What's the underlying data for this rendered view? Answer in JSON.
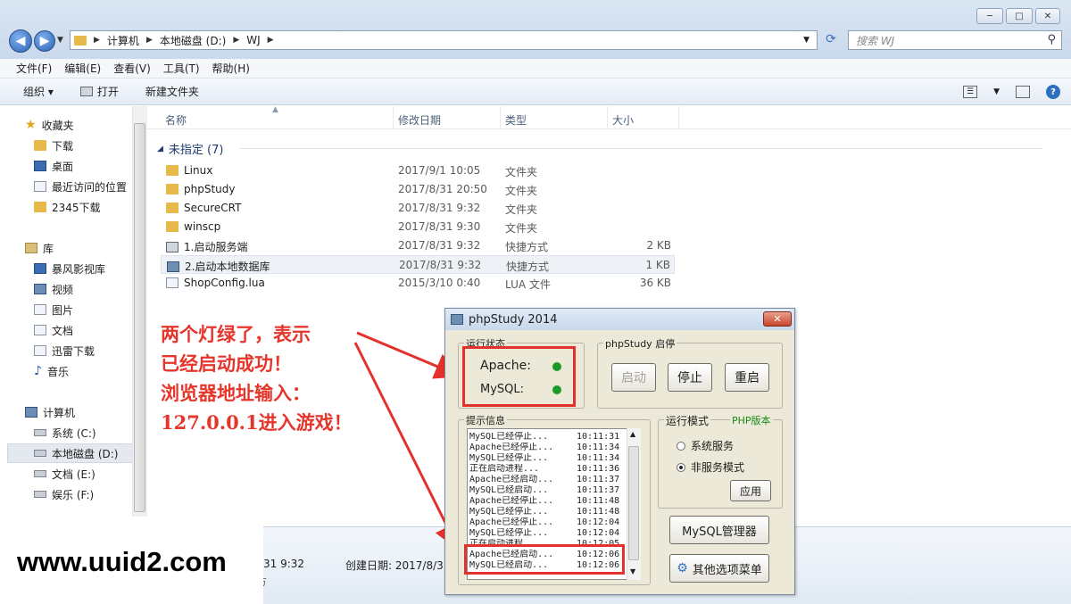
{
  "window": {
    "controls": [
      "─",
      "□",
      "✕"
    ]
  },
  "address": {
    "parts": [
      "计算机",
      "本地磁盘 (D:)",
      "WJ"
    ],
    "search_placeholder": "搜索 WJ"
  },
  "menu": [
    "文件(F)",
    "编辑(E)",
    "查看(V)",
    "工具(T)",
    "帮助(H)"
  ],
  "toolbar": {
    "organize": "组织 ▾",
    "open": "打开",
    "new_folder": "新建文件夹"
  },
  "sidebar": {
    "favorites": {
      "label": "收藏夹",
      "items": [
        "下载",
        "桌面",
        "最近访问的位置",
        "2345下载"
      ]
    },
    "libraries": {
      "label": "库",
      "items": [
        "暴风影视库",
        "视频",
        "图片",
        "文档",
        "迅雷下载",
        "音乐"
      ]
    },
    "computer": {
      "label": "计算机",
      "items": [
        "系统 (C:)",
        "本地磁盘 (D:)",
        "文档 (E:)",
        "娱乐 (F:)"
      ]
    }
  },
  "columns": [
    "名称",
    "修改日期",
    "类型",
    "大小"
  ],
  "group_label": "未指定 (7)",
  "files": [
    {
      "name": "Linux",
      "date": "2017/9/1 10:05",
      "type": "文件夹",
      "size": "",
      "icon": "folder-icon"
    },
    {
      "name": "phpStudy",
      "date": "2017/8/31 20:50",
      "type": "文件夹",
      "size": "",
      "icon": "folder-icon"
    },
    {
      "name": "SecureCRT",
      "date": "2017/8/31 9:32",
      "type": "文件夹",
      "size": "",
      "icon": "folder-icon"
    },
    {
      "name": "winscp",
      "date": "2017/8/31 9:30",
      "type": "文件夹",
      "size": "",
      "icon": "folder-icon"
    },
    {
      "name": "1.启动服务端",
      "date": "2017/8/31 9:32",
      "type": "快捷方式",
      "size": "2 KB",
      "icon": "shortcut-icon"
    },
    {
      "name": "2.启动本地数据库",
      "date": "2017/8/31 9:32",
      "type": "快捷方式",
      "size": "1 KB",
      "icon": "shortcut-icon"
    },
    {
      "name": "ShopConfig.lua",
      "date": "2015/3/10 0:40",
      "type": "LUA 文件",
      "size": "36 KB",
      "icon": "file-icon"
    }
  ],
  "details": {
    "modified_partial": "31 9:32",
    "created": "创建日期: 2017/8/31",
    "partial_char": "方"
  },
  "annotation": [
    "两个灯绿了，表示",
    "已经启动成功！",
    "浏览器地址输入：",
    "127.0.0.1进入游戏！"
  ],
  "watermark": "www.uuid2.com",
  "phpstudy": {
    "title": "phpStudy 2014",
    "close": "✕",
    "status_group": "运行状态",
    "apache": "Apache:",
    "mysql": "MySQL:",
    "control_group": "phpStudy 启停",
    "start": "启动",
    "stop": "停止",
    "restart": "重启",
    "log_group": "提示信息",
    "log": [
      {
        "msg": "MySQL已经停止...",
        "time": "10:11:31"
      },
      {
        "msg": "Apache已经停止...",
        "time": "10:11:34"
      },
      {
        "msg": "MySQL已经停止...",
        "time": "10:11:34"
      },
      {
        "msg": "正在启动进程...",
        "time": "10:11:36"
      },
      {
        "msg": "Apache已经启动...",
        "time": "10:11:37"
      },
      {
        "msg": "MySQL已经启动...",
        "time": "10:11:37"
      },
      {
        "msg": "Apache已经停止...",
        "time": "10:11:48"
      },
      {
        "msg": "MySQL已经停止...",
        "time": "10:11:48"
      },
      {
        "msg": "Apache已经停止...",
        "time": "10:12:04"
      },
      {
        "msg": "MySQL已经停止...",
        "time": "10:12:04"
      },
      {
        "msg": "正在启动进程...",
        "time": "10:12:05"
      },
      {
        "msg": "Apache已经启动...",
        "time": "10:12:06"
      },
      {
        "msg": "MySQL已经启动...",
        "time": "10:12:06"
      }
    ],
    "mode_group": "运行模式",
    "php_version": "PHP版本",
    "mode_system": "系统服务",
    "mode_nonservice": "非服务模式",
    "apply": "应用",
    "mysql_manager": "MySQL管理器",
    "other_menu": "其他选项菜单",
    "led_color": "#1c9a2a",
    "annotation_color": "#e6352b"
  }
}
